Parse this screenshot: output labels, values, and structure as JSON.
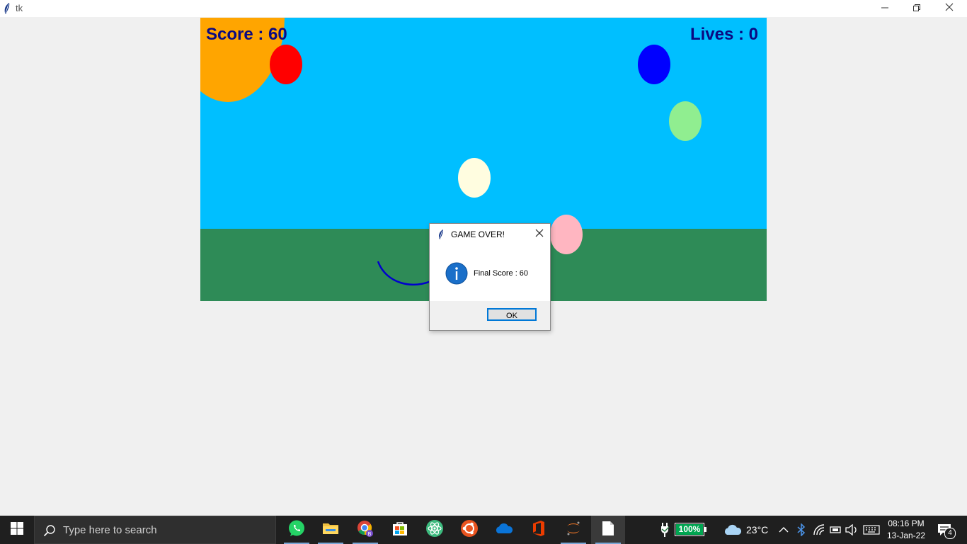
{
  "window": {
    "title": "tk"
  },
  "game": {
    "score_text": "Score : 60",
    "lives_text": "Lives : 0",
    "colors": {
      "sky": "#00bfff",
      "ground": "#2e8b57",
      "sun": "#ffa500",
      "hud_text": "#0a0a82",
      "basket": "#0000cd"
    },
    "balloons": [
      {
        "color": "#ff0000"
      },
      {
        "color": "#0000ff"
      },
      {
        "color": "#90ee90"
      },
      {
        "color": "#fffde0"
      },
      {
        "color": "#ffb6c1"
      }
    ]
  },
  "dialog": {
    "title": "GAME OVER!",
    "message": "Final Score : 60",
    "ok_label": "OK"
  },
  "taskbar": {
    "search_placeholder": "Type here to search",
    "apps": [
      "whatsapp-icon",
      "file-explorer-icon",
      "chrome-icon",
      "microsoft-store-icon",
      "atom-icon",
      "ubuntu-icon",
      "onedrive-icon",
      "office-icon",
      "jupyter-icon",
      "notepad-icon"
    ],
    "battery_percent": "100%",
    "weather_temp": "23°C",
    "time": "08:16 PM",
    "date": "13-Jan-22",
    "notification_count": "4"
  }
}
